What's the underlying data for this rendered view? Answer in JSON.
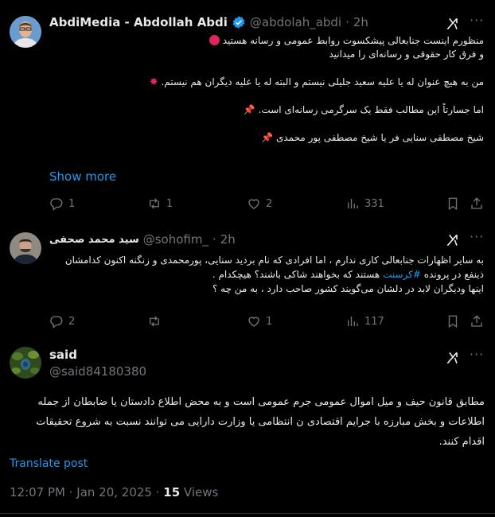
{
  "post1": {
    "display_name": "AbdiMedia - Abdollah Abdi",
    "handle": "@abdolah_abdi",
    "time": "2h",
    "lines": [
      "منظورم اینست جنابعالی پیشکسوت روابط عمومی و رسانه هستید",
      "و فرق کار حقوقی و رسانه‌ای را میدانید",
      "من به هیچ عنوان له یا علیه سعید جلیلی نیستم و البته له یا علیه دیگران هم نیستم.",
      "اما جسارتاً این مطالب فقط یک سرگرمی رسانه‌ای است.",
      "شیخ مصطفی سنایی فر یا شیخ مصطفی پور محمدی"
    ],
    "show_more": "Show more",
    "replies": "1",
    "reposts": "1",
    "likes": "2",
    "views": "331"
  },
  "post2": {
    "display_name": "سید محمد صحفی",
    "handle": "@sohofim_",
    "time": "2h",
    "line1": "به سایر اظهارات جنابعالی کاری ندارم ، اما افرادی که نام بردید سنایی، پورمحمدی و زنگنه اکنون کدامشان",
    "line2_pre": "ذینفع در پرونده",
    "hashtag": "#کرسنت",
    "line2_post": "هستند که بخواهند شاکی باشند؟ هیچکدام .",
    "line3": "اینها ودیگران لابد در دلشان می‌گویند کشور صاحب دارد ، به من چه ؟",
    "replies": "2",
    "likes": "1",
    "views": "117"
  },
  "post3": {
    "display_name": "said",
    "handle": "@said84180380",
    "lines": [
      "مطابق قانون حیف و میل اموال عمومی جرم عمومی است و به محض اطلاع دادستان یا ضابطان از جمله",
      "اطلاعات و بخش مبارزه با جرایم اقتصادی ن انتظامی یا وزارت دارایی می توانند نسبت به شروع تحقیقات",
      "اقدام کنند."
    ],
    "translate": "Translate post",
    "timestamp": "12:07 PM · Jan 20, 2025 · ",
    "views_count": "15",
    "views_label": " Views"
  },
  "icons": [
    "verified-badge-icon",
    "grok-icon",
    "more-icon",
    "reply-icon",
    "repost-icon",
    "like-icon",
    "views-icon",
    "bookmark-icon",
    "share-icon",
    "red-circle-emoji",
    "anger-emoji",
    "pushpin-emoji"
  ],
  "colors": {
    "background": "#000000",
    "text": "#e7e9ea",
    "secondary": "#71767b",
    "accent": "#1d9bf0",
    "divider": "#2f3336"
  }
}
